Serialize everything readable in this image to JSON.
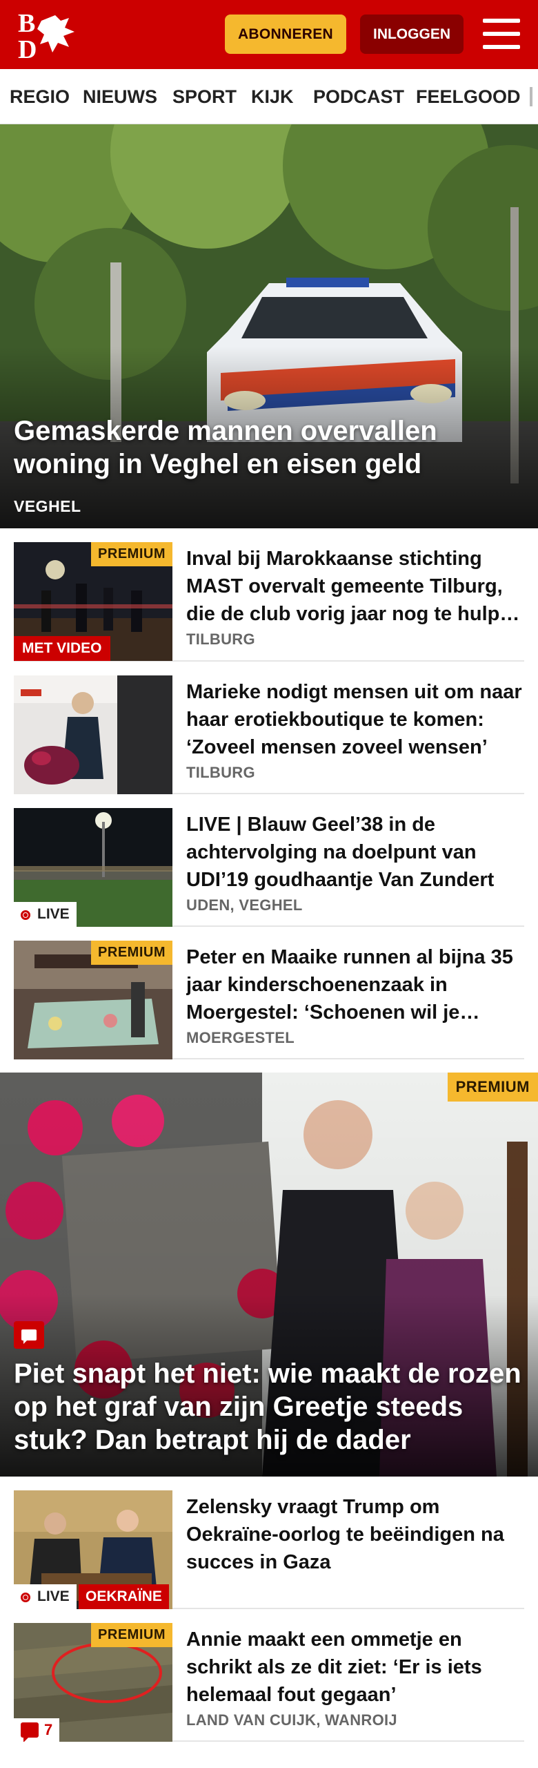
{
  "header": {
    "logo_text": "BD",
    "subscribe_label": "ABONNEREN",
    "login_label": "INLOGGEN",
    "menu_icon": "hamburger-menu-icon",
    "brand_color": "#cc0000"
  },
  "nav": {
    "items": [
      "REGIO",
      "NIEUWS",
      "SPORT",
      "KIJK",
      "PODCAST",
      "FEELGOOD"
    ]
  },
  "hero": {
    "title": "Gemaskerde mannen overvallen woning in Veghel en eisen geld",
    "location": "VEGHEL"
  },
  "articles": [
    {
      "title": "Inval bij Marokkaanse stichting MAST overvalt gemeente Tilburg, die de club vorig jaar nog te hulp schoot",
      "location": "TILBURG",
      "premium": "PREMIUM",
      "video": "MET VIDEO"
    },
    {
      "title": "Marieke nodigt mensen uit om naar haar erotiekboutique te komen: ‘Zoveel mensen zoveel wensen’",
      "location": "TILBURG"
    },
    {
      "title": "LIVE | Blauw Geel’38 in de achtervolging na doelpunt van UDI’19 goudhaantje Van Zundert",
      "location": "UDEN, VEGHEL",
      "live": "LIVE"
    },
    {
      "title": "Peter en Maaike runnen al bijna 35 jaar kinderschoenenzaak in Moergestel: ‘Schoenen wil je passen’",
      "location": "MOERGESTEL",
      "premium": "PREMIUM"
    }
  ],
  "feature": {
    "premium": "PREMIUM",
    "icon": "comment-icon",
    "title": "Piet snapt het niet: wie maakt de rozen op het graf van zijn Greetje steeds stuk? Dan betrapt hij de dader"
  },
  "articles2": [
    {
      "title": "Zelensky vraagt Trump om Oekraïne-oorlog te beëindigen na succes in Gaza",
      "live": "LIVE",
      "tag": "OEKRAÏNE"
    },
    {
      "title": "Annie maakt een ommetje en schrikt als ze dit ziet: ‘Er is iets helemaal fout gegaan’",
      "location": "LAND VAN CUIJK, WANROIJ",
      "premium": "PREMIUM",
      "comments": "7"
    }
  ]
}
